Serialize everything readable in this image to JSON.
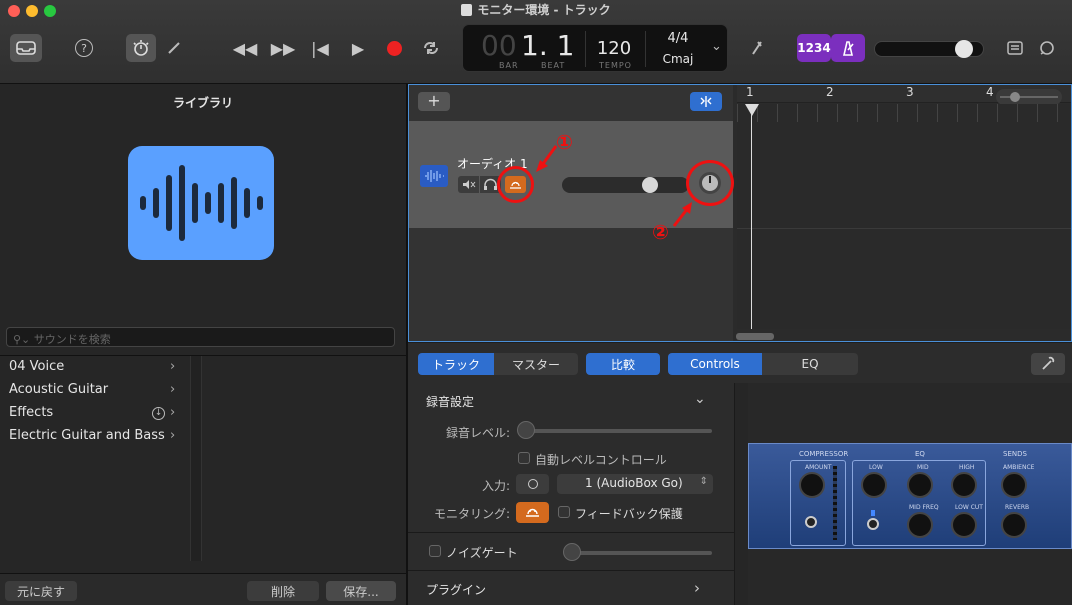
{
  "window": {
    "title": "モニター環境 - トラック"
  },
  "toolbar": {
    "help": "?",
    "lcd": {
      "bar_dim": "00",
      "position": "1. 1",
      "bar_label": "BAR",
      "beat_label": "BEAT",
      "tempo": "120",
      "tempo_label": "TEMPO",
      "time_sig": "4/4",
      "key": "Cmaj"
    },
    "count_in": "1234"
  },
  "library": {
    "title": "ライブラリ",
    "search_placeholder": "サウンドを検索",
    "items": [
      {
        "label": "04 Voice"
      },
      {
        "label": "Acoustic Guitar"
      },
      {
        "label": "Effects"
      },
      {
        "label": "Electric Guitar and Bass"
      }
    ],
    "revert": "元に戻す",
    "delete": "削除",
    "save": "保存..."
  },
  "tracks": {
    "add": "+",
    "track_name": "オーディオ 1",
    "ruler": [
      "1",
      "2",
      "3",
      "4"
    ]
  },
  "annotations": {
    "one": "①",
    "two": "②",
    "color": "#e11111"
  },
  "editor": {
    "tab_track": "トラック",
    "tab_master": "マスター",
    "compare": "比較",
    "tab_controls": "Controls",
    "tab_eq": "EQ"
  },
  "inspector": {
    "section_recording": "録音設定",
    "record_level": "録音レベル:",
    "auto_level": "自動レベルコントロール",
    "input_label": "入力:",
    "input_value": "1  (AudioBox Go)",
    "monitoring_label": "モニタリング:",
    "feedback": "フィードバック保護",
    "noise_gate": "ノイズゲート",
    "plugins": "プラグイン"
  },
  "plugin": {
    "compressor": "COMPRESSOR",
    "eq": "EQ",
    "sends": "SENDS",
    "amount": "AMOUNT",
    "low": "LOW",
    "mid": "MID",
    "high": "HIGH",
    "midfreq": "MID FREQ",
    "lowcut": "LOW CUT",
    "ambience": "AMBIENCE",
    "reverb": "REVERB"
  }
}
